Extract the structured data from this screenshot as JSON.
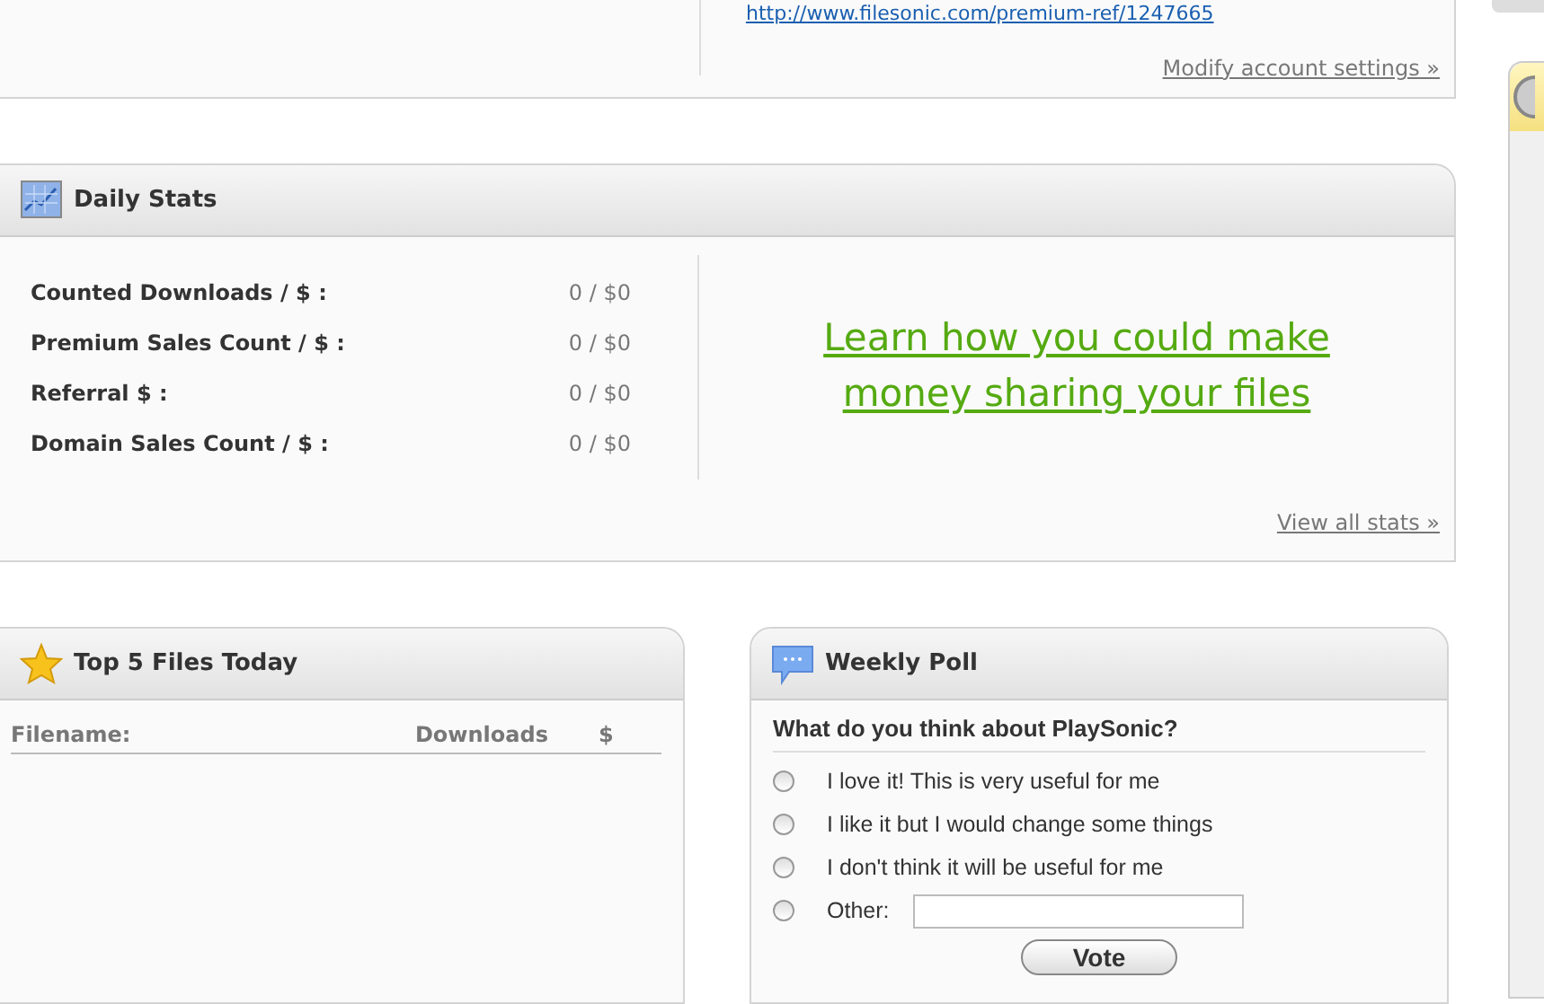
{
  "account_panel": {
    "referral_link": "http://www.filesonic.com/premium-ref/1247665",
    "settings_link": "Modify account settings »"
  },
  "daily_stats": {
    "title": "Daily Stats",
    "rows": [
      {
        "label": "Counted Downloads / $ :",
        "value": "0 / $0"
      },
      {
        "label": "Premium Sales Count / $ :",
        "value": "0 / $0"
      },
      {
        "label": "Referral $ :",
        "value": "0 / $0"
      },
      {
        "label": "Domain Sales Count / $ :",
        "value": "0 / $0"
      }
    ],
    "promo_link": "Learn how you could make money sharing your files",
    "view_all_link": "View all stats »"
  },
  "top_files": {
    "title": "Top 5 Files Today",
    "columns": [
      "Filename:",
      "Downloads",
      "$"
    ]
  },
  "weekly_poll": {
    "title": "Weekly Poll",
    "question": "What do you think about PlaySonic?",
    "options": [
      {
        "kind": "choice",
        "label": "I love it! This is very useful for me",
        "selected": false
      },
      {
        "kind": "choice",
        "label": "I like it but I would change some things",
        "selected": false
      },
      {
        "kind": "choice",
        "label": "I don't think it will be useful for me",
        "selected": false
      },
      {
        "kind": "other",
        "label": "Other:",
        "selected": false
      }
    ],
    "vote_button": "Vote"
  }
}
